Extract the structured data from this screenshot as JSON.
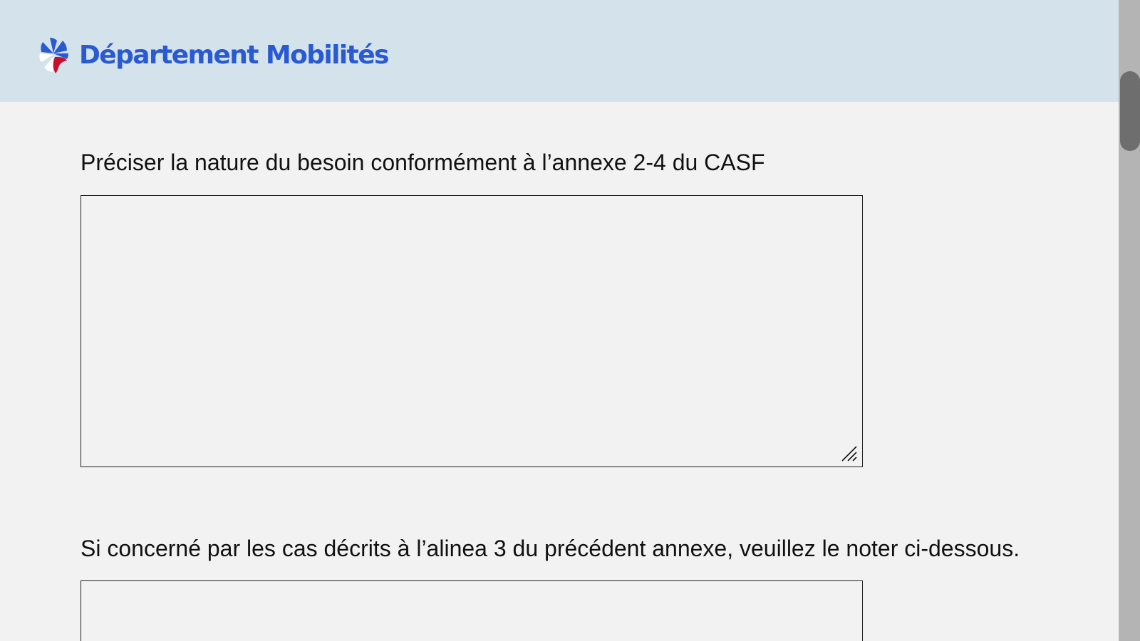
{
  "header": {
    "brand_name": "Département Mobilités",
    "logo_icon": "mobility-logo-icon",
    "background_color": "#d4e2ec",
    "brand_color": "#2a5ad1"
  },
  "form": {
    "fields": [
      {
        "label": "Préciser la nature du besoin conformément à l’annexe 2-4 du CASF",
        "value": ""
      },
      {
        "label": "Si concerné par les cas décrits à l’alinea 3 du précédent annexe, veuillez le noter ci-dessous.",
        "value": ""
      }
    ]
  },
  "colors": {
    "logo_blue": "#2a5ad1",
    "logo_red": "#c8102e",
    "logo_white": "#ffffff",
    "page_background": "#f2f2f2",
    "scrollbar_track": "#b4b4b4",
    "scrollbar_thumb": "#6e6e6e"
  }
}
